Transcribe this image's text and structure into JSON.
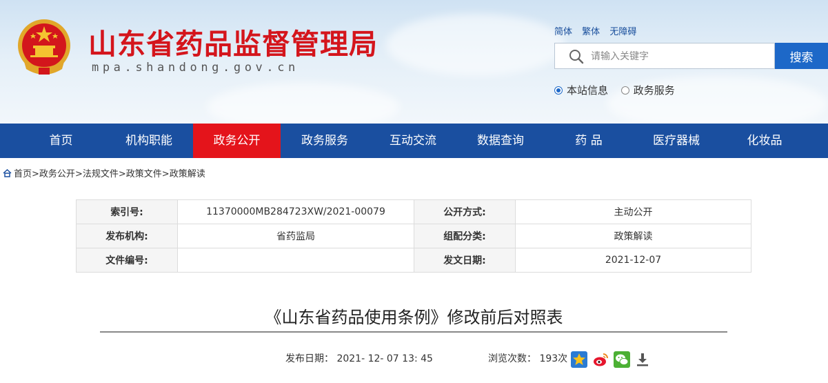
{
  "header": {
    "site_title": "山东省药品监督管理局",
    "site_url": "mpa.shandong.gov.cn",
    "lang_links": [
      "简体",
      "繁体",
      "无障碍"
    ],
    "search": {
      "placeholder": "请输入关键字",
      "button": "搜索"
    },
    "scope_options": [
      {
        "label": "本站信息",
        "checked": true
      },
      {
        "label": "政务服务",
        "checked": false
      }
    ]
  },
  "nav": {
    "items": [
      "首页",
      "机构职能",
      "政务公开",
      "政务服务",
      "互动交流",
      "数据查询",
      "药 品",
      "医疗器械",
      "化妆品"
    ],
    "active": "政务公开"
  },
  "breadcrumb": [
    "首页",
    "政务公开",
    "法规文件",
    "政策文件",
    "政策解读"
  ],
  "meta": {
    "index_no_label": "索引号:",
    "index_no": "11370000MB284723XW/2021-00079",
    "open_mode_label": "公开方式:",
    "open_mode": "主动公开",
    "issuer_label": "发布机构:",
    "issuer": "省药监局",
    "category_label": "组配分类:",
    "category": "政策解读",
    "doc_no_label": "文件编号:",
    "doc_no": "",
    "issue_date_label": "发文日期:",
    "issue_date": "2021-12-07"
  },
  "article": {
    "title": "《山东省药品使用条例》修改前后对照表",
    "publish_date_label": "发布日期：",
    "publish_date": "2021- 12- 07 13: 45",
    "views_label": "浏览次数：",
    "views": "193次"
  },
  "share_icons": [
    "star-icon",
    "weibo-icon",
    "wechat-icon",
    "download-icon"
  ],
  "colors": {
    "nav_bg": "#1a4fa0",
    "nav_active": "#e4141b",
    "title_red": "#d4151c",
    "search_btn": "#1d68c8"
  }
}
